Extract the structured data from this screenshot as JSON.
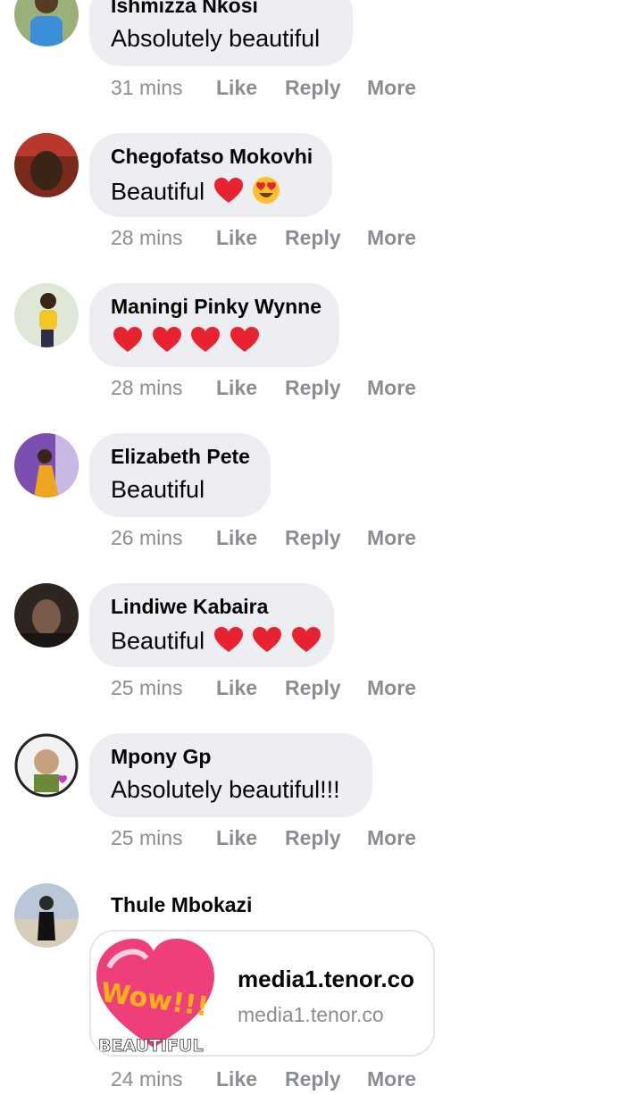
{
  "actions": {
    "like": "Like",
    "reply": "Reply",
    "more": "More"
  },
  "comments": [
    {
      "author": "Ishmizza Nkosi",
      "text": "Absolutely beautiful",
      "hearts": 0,
      "starEyes": false,
      "time": "31 mins"
    },
    {
      "author": "Chegofatso Mokovhi",
      "text": "Beautiful",
      "hearts": 1,
      "starEyes": true,
      "time": "28 mins"
    },
    {
      "author": "Maningi Pinky Wynne",
      "text": "",
      "hearts": 4,
      "starEyes": false,
      "time": "28 mins"
    },
    {
      "author": "Elizabeth Pete",
      "text": "Beautiful",
      "hearts": 0,
      "starEyes": false,
      "time": "26 mins"
    },
    {
      "author": "Lindiwe Kabaira",
      "text": "Beautiful",
      "hearts": 3,
      "starEyes": false,
      "time": "25 mins"
    },
    {
      "author": "Mpony Gp",
      "text": "Absolutely beautiful!!!",
      "hearts": 0,
      "starEyes": false,
      "time": "25 mins"
    }
  ],
  "last_comment": {
    "author": "Thule Mbokazi",
    "time": "24 mins",
    "link": {
      "title": "media1.tenor.co",
      "domain": "media1.tenor.co",
      "thumb_text_1": "Wow!!!",
      "thumb_text_2": "BEAUTIFUL"
    }
  },
  "colors": {
    "bubble": "#eceef1",
    "meta": "#8a8d91",
    "text": "#050505",
    "heart": "#e8232f"
  },
  "icons": {
    "heart": "red-heart-icon",
    "star_eyes": "star-eyes-emoji-icon"
  }
}
